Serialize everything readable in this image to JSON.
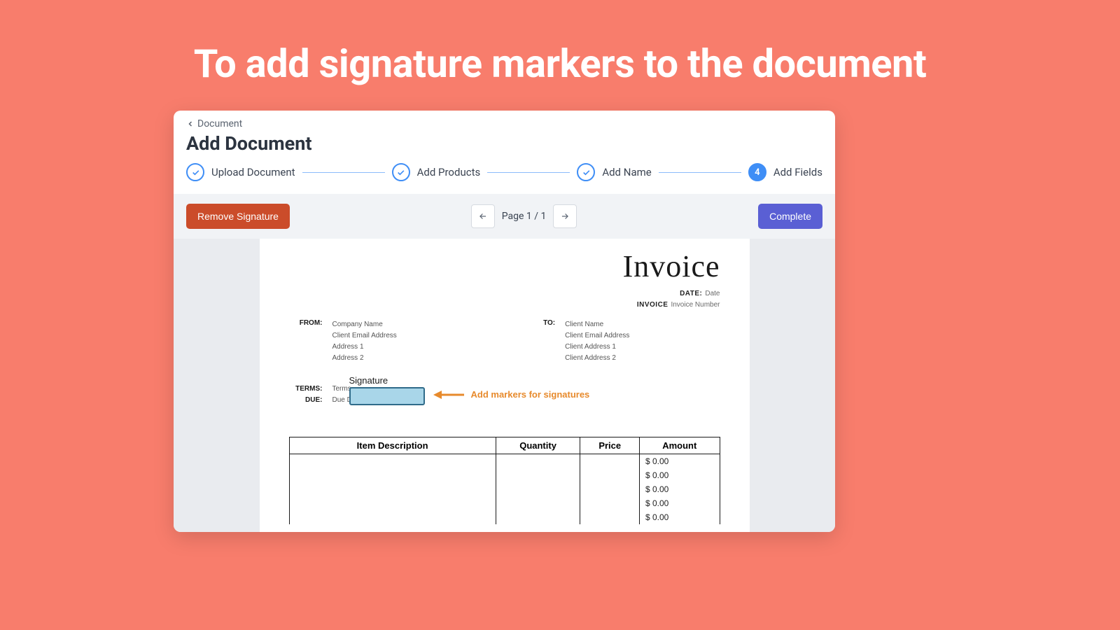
{
  "slide": {
    "title": "To add signature markers to the document"
  },
  "breadcrumb": {
    "label": "Document"
  },
  "page": {
    "title": "Add Document"
  },
  "steps": [
    {
      "label": "Upload Document",
      "done": true
    },
    {
      "label": "Add Products",
      "done": true
    },
    {
      "label": "Add Name",
      "done": true
    },
    {
      "label": "Add Fields",
      "current": true,
      "number": "4"
    }
  ],
  "toolbar": {
    "remove_label": "Remove Signature",
    "page_text": "Page 1 / 1",
    "complete_label": "Complete"
  },
  "invoice": {
    "heading": "Invoice",
    "date_label": "DATE:",
    "date_value": "Date",
    "number_label": "INVOICE",
    "number_value": "Invoice Number",
    "from_label": "FROM:",
    "from_lines": [
      "Company Name",
      "Client Email Address",
      "Address 1",
      "Address 2"
    ],
    "to_label": "TO:",
    "to_lines": [
      "Client Name",
      "Client Email Address",
      "Client Address 1",
      "Client Address 2"
    ],
    "terms_label": "TERMS:",
    "terms_value": "Terms",
    "due_label": "DUE:",
    "due_value": "Due Date",
    "table_headers": [
      "Item Description",
      "Quantity",
      "Price",
      "Amount"
    ],
    "amounts": [
      "$ 0.00",
      "$ 0.00",
      "$ 0.00",
      "$ 0.00",
      "$ 0.00"
    ]
  },
  "signature": {
    "label": "Signature",
    "annotation": "Add markers for signatures"
  },
  "colors": {
    "background": "#f87d6c",
    "primary_blue": "#3f8ef6",
    "danger": "#cb4c2a",
    "complete": "#5a5fd4",
    "annotation": "#e78a2c"
  }
}
